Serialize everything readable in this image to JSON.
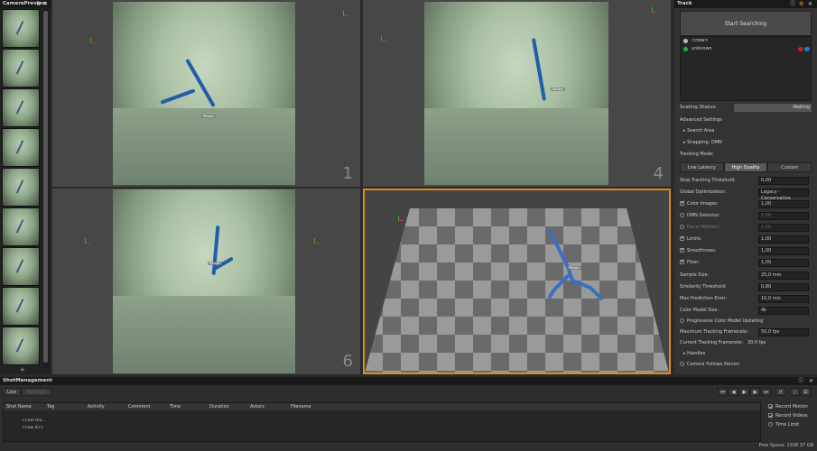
{
  "camera_preview": {
    "title": "CameraPreview",
    "add_label": "+"
  },
  "viewports": {
    "v1": "1",
    "v2": "4",
    "v3": "6",
    "person_label": "Person"
  },
  "track": {
    "title": "Track",
    "start_button": "Start Searching",
    "persons": [
      "<new>",
      "unknown"
    ],
    "scaling_status_label": "Scaling Status:",
    "scaling_status_value": "Waiting",
    "advanced_settings": "Advanced Settings",
    "search_area": "Search Area",
    "snapping": "Snapping: DMN",
    "tracking_mode_label": "Tracking Mode:",
    "modes": [
      "Low Latency",
      "High Quality",
      "Custom"
    ],
    "rows": [
      {
        "label": "Stop Tracking Threshold:",
        "value": "0,00"
      },
      {
        "label": "Global Optimization:",
        "value": "Legacy - Conservative"
      },
      {
        "label": "Color Images:",
        "value": "1,00"
      },
      {
        "label": "DMN Detector:",
        "value": "1,00"
      },
      {
        "label": "Facial Markers:",
        "value": "1,00"
      },
      {
        "label": "Limits:",
        "value": "1,00"
      },
      {
        "label": "Smoothness:",
        "value": "1,00"
      },
      {
        "label": "Floor:",
        "value": "1,00"
      },
      {
        "label": "Sample Size:",
        "value": "25,0 mm"
      },
      {
        "label": "Similarity Threshold:",
        "value": "0,80"
      },
      {
        "label": "Max Prediction Error:",
        "value": "10,0 m/s"
      },
      {
        "label": "Color Model Size:",
        "value": "4k"
      }
    ],
    "progressive": "Progressive Color Model Updating",
    "max_framerate_label": "Maximum Tracking Framerate:",
    "max_framerate_value": "50,0 fps",
    "current_framerate_label": "Current Tracking Framerate:",
    "current_framerate_value": "30.0 fps",
    "handles": "Handles",
    "camera_follows": "Camera Follows Person"
  },
  "shot": {
    "title": "ShotManagement",
    "tabs": [
      "Live",
      "Playback"
    ],
    "columns": [
      "Shot Name",
      "Tag",
      "Activity",
      "Comment",
      "Time",
      "Duration",
      "Actors",
      "Filename"
    ],
    "rows": [
      "<new sho...",
      "<new dir>"
    ],
    "record_motion": "Record Motion",
    "record_videos": "Record Videos",
    "time_limit": "Time Limit",
    "free_space": "Free Space: 1508.37 GB"
  }
}
